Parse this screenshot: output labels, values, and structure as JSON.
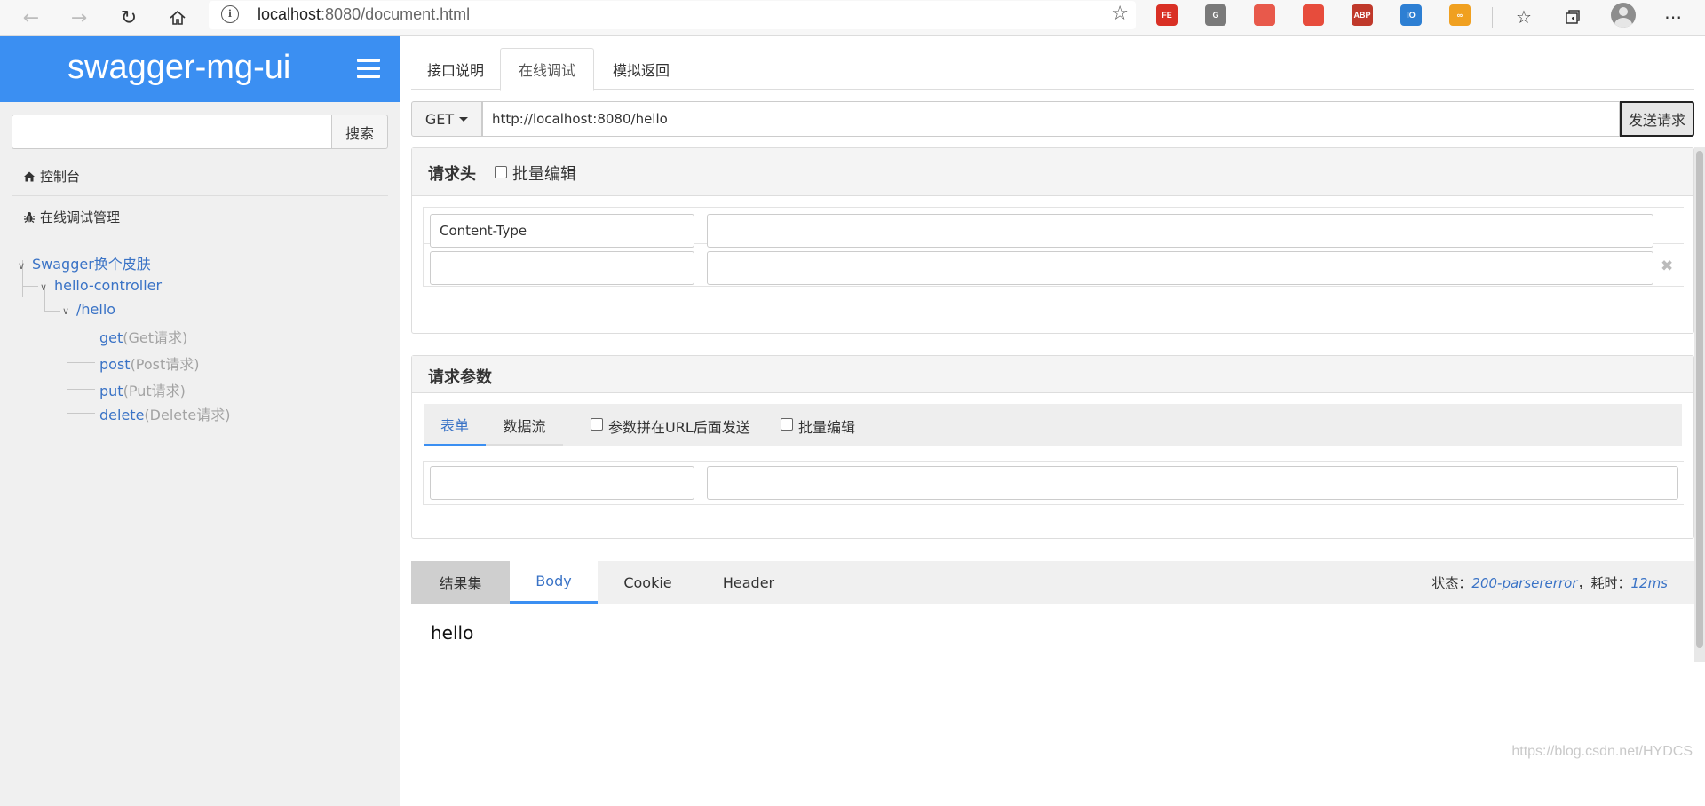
{
  "browser": {
    "address": {
      "host": "localhost",
      "rest": ":8080/document.html"
    },
    "extensions": [
      {
        "name": "FE",
        "color": "#d93025"
      },
      {
        "name": "G",
        "color": "#7a7a7a"
      },
      {
        "name": "",
        "color": "#e8594b"
      },
      {
        "name": "",
        "color": "#e74c3c"
      },
      {
        "name": "ABP",
        "color": "#c0392b"
      },
      {
        "name": "IO",
        "color": "#2d7fd3"
      },
      {
        "name": "∞",
        "color": "#f0a020"
      }
    ]
  },
  "sidebar": {
    "brand": "swagger-mg-ui",
    "search": {
      "button": "搜索",
      "placeholder": ""
    },
    "menu": {
      "console": "控制台",
      "debug_manage": "在线调试管理"
    },
    "tree": {
      "root": "Swagger换个皮肤",
      "controller": "hello-controller",
      "path": "/hello",
      "methods": [
        {
          "method": "get",
          "desc": "(Get请求)"
        },
        {
          "method": "post",
          "desc": "(Post请求)"
        },
        {
          "method": "put",
          "desc": "(Put请求)"
        },
        {
          "method": "delete",
          "desc": "(Delete请求)"
        }
      ]
    }
  },
  "main": {
    "tabs": [
      "接口说明",
      "在线调试",
      "模拟返回"
    ],
    "active_tab": "在线调试",
    "request": {
      "method": "GET",
      "url": "http://localhost:8080/hello",
      "send": "发送请求"
    },
    "headers": {
      "title": "请求头",
      "batch_edit": "批量编辑",
      "rows": [
        {
          "key": "Content-Type",
          "value": ""
        },
        {
          "key": "",
          "value": ""
        }
      ],
      "remove_symbol": "✖"
    },
    "params": {
      "title": "请求参数",
      "tabs": [
        "表单",
        "数据流"
      ],
      "append_to_url": "参数拼在URL后面发送",
      "batch_edit": "批量编辑",
      "rows": [
        {
          "key": "",
          "value": ""
        }
      ]
    },
    "result": {
      "tabs": [
        "结果集",
        "Body",
        "Cookie",
        "Header"
      ],
      "active": "Body",
      "status_label": "状态：",
      "status_value": "200-parsererror",
      "time_label": "，耗时：",
      "time_value": "12ms",
      "body": "hello"
    }
  },
  "watermark": "https://blog.csdn.net/HYDCS",
  "colors": {
    "brand": "#3b8ff2",
    "link": "#3a73c6",
    "muted": "#a3a3a3"
  }
}
